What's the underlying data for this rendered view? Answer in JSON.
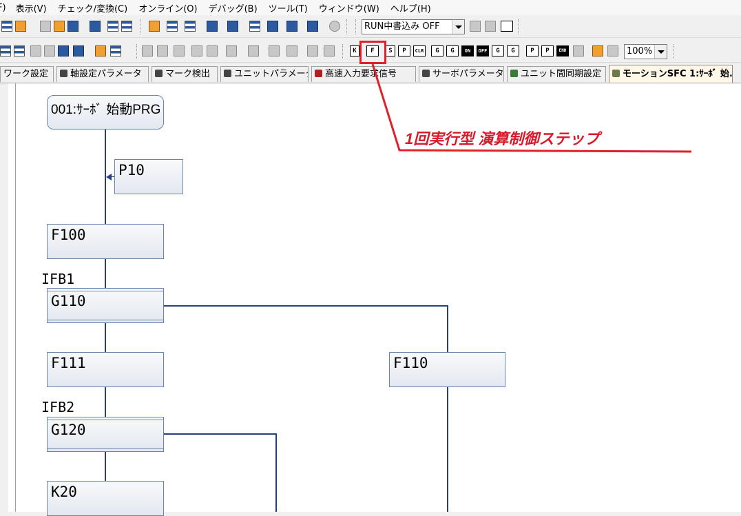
{
  "menu": {
    "items": [
      "F)",
      "表示(V)",
      "チェック/変換(C)",
      "オンライン(O)",
      "デバッグ(B)",
      "ツール(T)",
      "ウィンドウ(W)",
      "ヘルプ(H)"
    ]
  },
  "toolbar": {
    "run_write_mode": "RUN中書込み OFF",
    "zoom": "100%",
    "step_buttons": [
      "K",
      "F",
      "S",
      "P",
      "CLR",
      "G",
      "G",
      "ON",
      "OFF",
      "G",
      "G",
      "P",
      "P",
      "END"
    ]
  },
  "tabs": [
    {
      "label": "ワーク設定",
      "icon": "workpiece-icon"
    },
    {
      "label": "軸設定パラメータ",
      "icon": "axis-settings-icon"
    },
    {
      "label": "マーク検出",
      "icon": "mark-detection-icon"
    },
    {
      "label": "ユニットパラメータ",
      "icon": "unit-parameter-icon"
    },
    {
      "label": "高速入力要求信号",
      "icon": "high-speed-input-icon"
    },
    {
      "label": "サーボパラメータ",
      "icon": "servo-parameter-icon"
    },
    {
      "label": "ユニット間同期設定",
      "icon": "unit-sync-icon"
    },
    {
      "label": "モーションSFC 1:ｻｰﾎﾞ 始...",
      "icon": "motion-sfc-icon",
      "active": true
    }
  ],
  "sfc": {
    "start_program": "001:ｻｰﾎﾞ 始動PRG",
    "p10": "P10",
    "f100": "F100",
    "ifb1": "IFB1",
    "g110": "G110",
    "f111": "F111",
    "f110": "F110",
    "ifb2": "IFB2",
    "g120": "G120",
    "k20": "K20"
  },
  "annotation": {
    "text": "1回実行型 演算制御ステップ",
    "color": "#d91a2a"
  },
  "colors": {
    "wire": "#24427a",
    "step_border": "#6a84ad",
    "annotation": "#d91a2a"
  }
}
